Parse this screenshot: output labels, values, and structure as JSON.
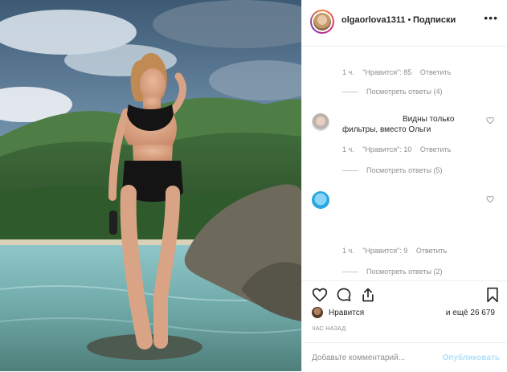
{
  "header": {
    "username": "olgaorlova1311",
    "separator": "•",
    "follow_label": "Подписки",
    "more_icon": "ellipsis-icon"
  },
  "comments": [
    {
      "time": "1 ч.",
      "likes": "\"Нравится\": 85",
      "reply": "Ответить",
      "view_replies": "Посмотреть ответы (4)"
    },
    {
      "text_line1": "Видны только",
      "text_line2": "фильтры, вместо Ольги",
      "time": "1 ч.",
      "likes": "\"Нравится\": 10",
      "reply": "Ответить",
      "view_replies": "Посмотреть ответы (5)"
    },
    {
      "time": "1 ч.",
      "likes": "\"Нравится\": 9",
      "reply": "Ответить",
      "view_replies": "Посмотреть ответы (2)"
    }
  ],
  "actions": {
    "liked_by_prefix": "Нравится",
    "and_more": "и ещё 26 679",
    "time_ago": "ЧАС НАЗАД",
    "comment_placeholder": "Добавьте комментарий...",
    "publish_label": "Опубликовать"
  },
  "colors": {
    "link_blue_disabled": "#b2dffc",
    "muted_text": "#8e8e8e",
    "border": "#efefef"
  }
}
